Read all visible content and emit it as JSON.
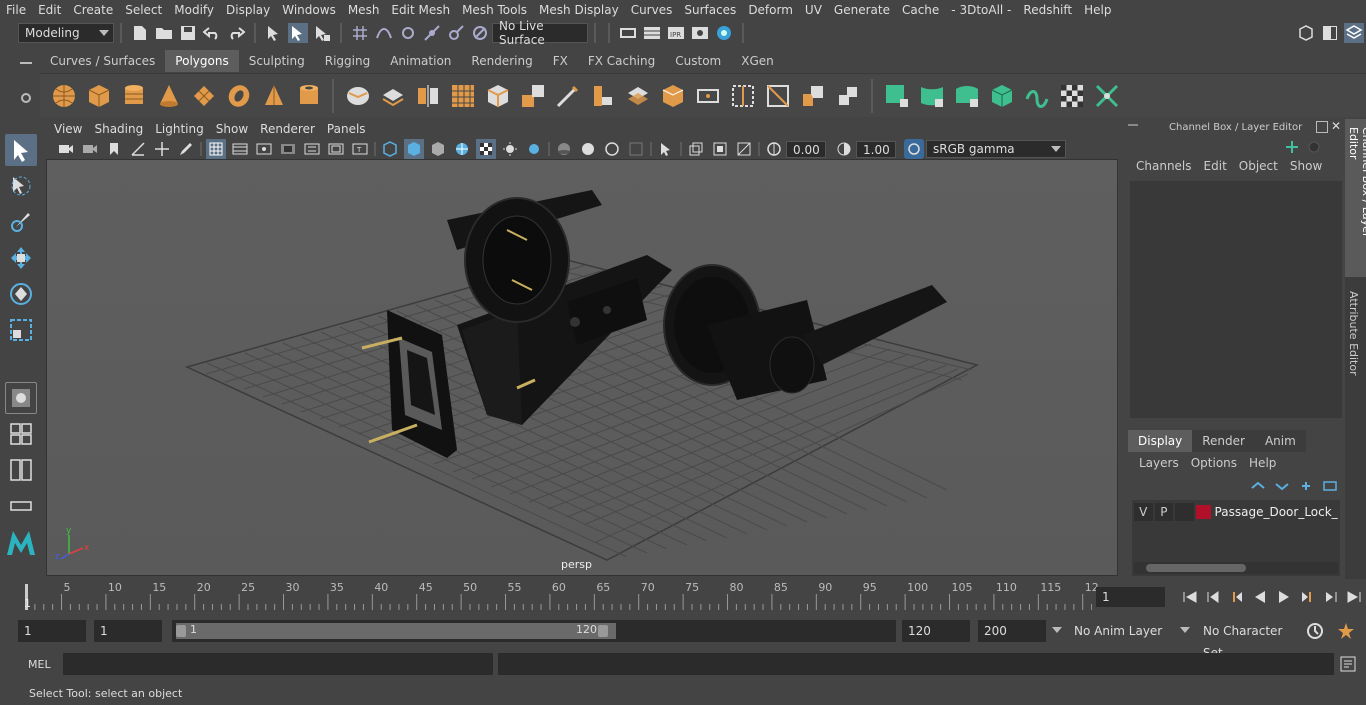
{
  "menubar": {
    "items": [
      "File",
      "Edit",
      "Create",
      "Select",
      "Modify",
      "Display",
      "Windows",
      "Mesh",
      "Edit Mesh",
      "Mesh Tools",
      "Mesh Display",
      "Curves",
      "Surfaces",
      "Deform",
      "UV",
      "Generate",
      "Cache",
      "- 3DtoAll -",
      "Redshift",
      "Help"
    ]
  },
  "statusline": {
    "mode": "Modeling",
    "live_surface": "No Live Surface"
  },
  "shelf": {
    "tabs": [
      "Curves / Surfaces",
      "Polygons",
      "Sculpting",
      "Rigging",
      "Animation",
      "Rendering",
      "FX",
      "FX Caching",
      "Custom",
      "XGen"
    ],
    "active_tab": "Polygons"
  },
  "viewport": {
    "menu": [
      "View",
      "Shading",
      "Lighting",
      "Show",
      "Renderer",
      "Panels"
    ],
    "exposure": "0.00",
    "gamma": "1.00",
    "color_space": "sRGB gamma",
    "camera_label": "persp",
    "axis_x": "x",
    "axis_y": "y",
    "axis_z": "z"
  },
  "channelbox": {
    "title": "Channel Box / Layer Editor",
    "menu": [
      "Channels",
      "Edit",
      "Object",
      "Show"
    ]
  },
  "layereditor": {
    "tabs": [
      "Display",
      "Render",
      "Anim"
    ],
    "active_tab": "Display",
    "menu": [
      "Layers",
      "Options",
      "Help"
    ],
    "layer": {
      "v": "V",
      "p": "P",
      "name": "Passage_Door_Lock_w",
      "color": "#b0102a"
    }
  },
  "side_tabs": [
    "Channel Box / Layer Editor",
    "Attribute Editor"
  ],
  "timeslider": {
    "ticks": [
      "5",
      "10",
      "15",
      "20",
      "25",
      "30",
      "35",
      "40",
      "45",
      "50",
      "55",
      "60",
      "65",
      "70",
      "75",
      "80",
      "85",
      "90",
      "95",
      "100",
      "105",
      "110",
      "115",
      "12"
    ],
    "start_label": "1",
    "current_frame": "1"
  },
  "range": {
    "start": "1",
    "start2": "1",
    "slider_start": "1",
    "slider_end": "120",
    "end": "120",
    "max": "200",
    "anim_layer": "No Anim Layer",
    "character_set": "No Character Set"
  },
  "cmdline": {
    "label": "MEL"
  },
  "helpline": {
    "text": "Select Tool: select an object"
  },
  "colors": {
    "accent": "#5b6f85",
    "shelf_orange": "#e09a4a",
    "shelf_green": "#3fbf8f",
    "bg": "#444444",
    "viewport": "#5d5d5d"
  }
}
